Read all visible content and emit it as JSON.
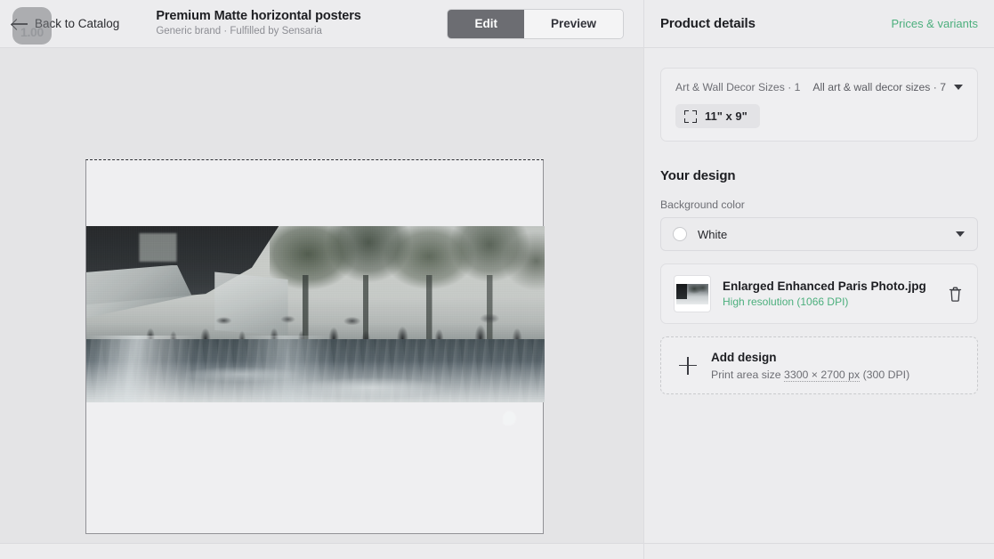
{
  "editor": {
    "back_label": "Back to Catalog",
    "product_title": "Premium Matte horizontal posters",
    "product_subtitle": "Generic brand · Fulfilled by Sensaria",
    "mode_edit": "Edit",
    "mode_preview": "Preview",
    "zoom_badge": "1.00",
    "canvas": {
      "artboard_background": "#efeff1",
      "bleed_guide": "dashed-top-edge",
      "artwork_alt": "Vintage rainy Paris boulevard street scene with wet reflective pavement, tree-lined avenue and pedestrians"
    }
  },
  "panel": {
    "title": "Product details",
    "prices_link": "Prices & variants",
    "sizes": {
      "category_label": "Art & Wall Decor Sizes · 1",
      "all_sizes_label": "All art & wall decor sizes · 7",
      "selected_size": "11\" x 9\""
    },
    "design": {
      "section_title": "Your design",
      "background_color_label": "Background color",
      "background_color_value": "White",
      "background_color_swatch": "#ffffff",
      "file": {
        "name": "Enlarged Enhanced Paris Photo.jpg",
        "resolution": "High resolution (1066 DPI)"
      },
      "add": {
        "title": "Add design",
        "subtitle_prefix": "Print area size ",
        "subtitle_dims": "3300 × 2700 px",
        "subtitle_suffix": " (300 DPI)"
      }
    }
  },
  "colors": {
    "accent_green": "#4caf7d",
    "toggle_active_bg": "#6c6d72",
    "panel_bg": "#ececee",
    "canvas_bg": "#e4e4e6"
  }
}
